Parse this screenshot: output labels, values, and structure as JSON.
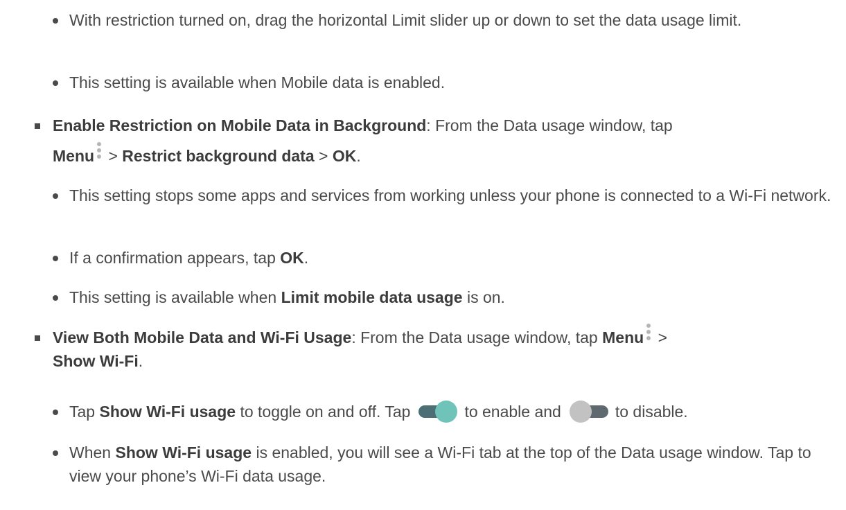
{
  "list": {
    "limit_slider": "With restriction turned on, drag the horizontal Limit slider up or down to set the data usage limit.",
    "limit_available": "This setting is available when Mobile data is enabled.",
    "restriction": {
      "title": "Enable Restriction on Mobile Data in Background",
      "text1": ": From the Data usage window, tap ",
      "menu": "Menu",
      "sep1": " > ",
      "restrict": "Restrict background data",
      "sep2": " > ",
      "ok": "OK",
      "end": "."
    },
    "stops_apps": "This setting stops some apps and services from working unless your phone is connected to a Wi-Fi network.",
    "confirmation": {
      "text": "If a confirmation appears, tap ",
      "ok": "OK",
      "end": "."
    },
    "available_limit": {
      "text": "This setting is available when ",
      "bold": "Limit mobile data usage",
      "end": " is on."
    },
    "view_both": {
      "title": "View Both Mobile Data and Wi-Fi Usage",
      "text1": ": From the Data usage window, tap ",
      "menu": "Menu",
      "sep": " > ",
      "show_wifi": "Show Wi-Fi",
      "end": "."
    },
    "tap_show": {
      "text1": "Tap ",
      "bold": "Show Wi-Fi usage",
      "text2": " to toggle on and off. Tap",
      "text3": "to enable and",
      "text4": "to disable."
    },
    "when_show": {
      "text1": "When ",
      "bold": "Show Wi-Fi usage",
      "text2": " is enabled, you will see a Wi-Fi tab at the top of the Data usage window. Tap to view your phone’s Wi-Fi data usage."
    }
  },
  "icons": {
    "menu": "menu-kebab-icon",
    "toggle_on": "toggle-on-icon",
    "toggle_off": "toggle-off-icon"
  },
  "colors": {
    "text": "#4a4a4a",
    "toggle_on_knob": "#6fc3b9",
    "toggle_on_track": "#4b6f75",
    "toggle_off_knob": "#c2c2c2",
    "toggle_off_track": "#5f6a70"
  }
}
